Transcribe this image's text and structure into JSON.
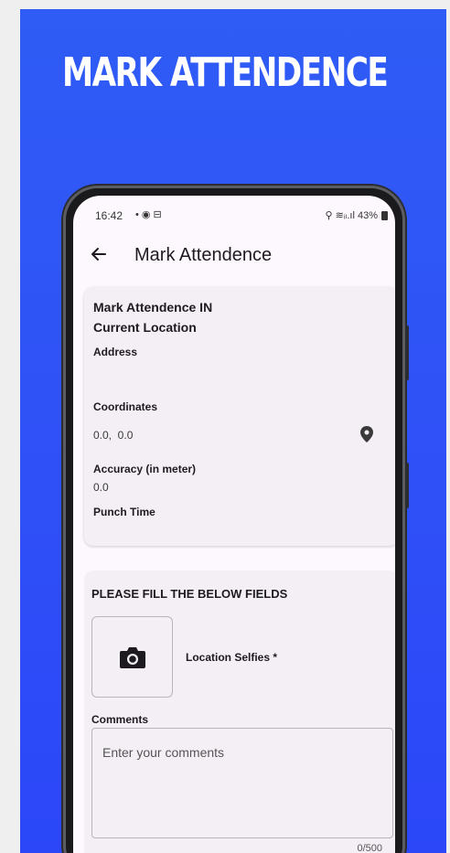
{
  "promo": {
    "title": "MARK ATTENDENCE"
  },
  "status_bar": {
    "time": "16:42",
    "left_icons": "• ◉ ⊟",
    "right_indicators": "⚲ ≋ᵢₗ.ıl 43%"
  },
  "app_bar": {
    "title": "Mark Attendence"
  },
  "location_card": {
    "heading": "Mark Attendence IN",
    "subheading": "Current Location",
    "address_label": "Address",
    "address_value": "",
    "coordinates_label": "Coordinates",
    "coordinates_value": "0.0,  0.0",
    "accuracy_label": "Accuracy (in meter)",
    "accuracy_value": "0.0",
    "punch_time_label": "Punch Time",
    "punch_time_value": ""
  },
  "form_card": {
    "heading": "PLEASE FILL THE BELOW FIELDS",
    "selfie_label": "Location Selfies *",
    "comments_label": "Comments",
    "comments_placeholder": "Enter your comments",
    "comments_value": "",
    "char_counter": "0/500"
  },
  "colors": {
    "promo_background": "#2f52f6",
    "screen_background": "#fdf8fd",
    "card_background": "#f4eff4",
    "text_primary": "#1d1b20"
  },
  "icons": {
    "back": "arrow-left-icon",
    "location": "map-pin-icon",
    "camera": "camera-icon"
  }
}
